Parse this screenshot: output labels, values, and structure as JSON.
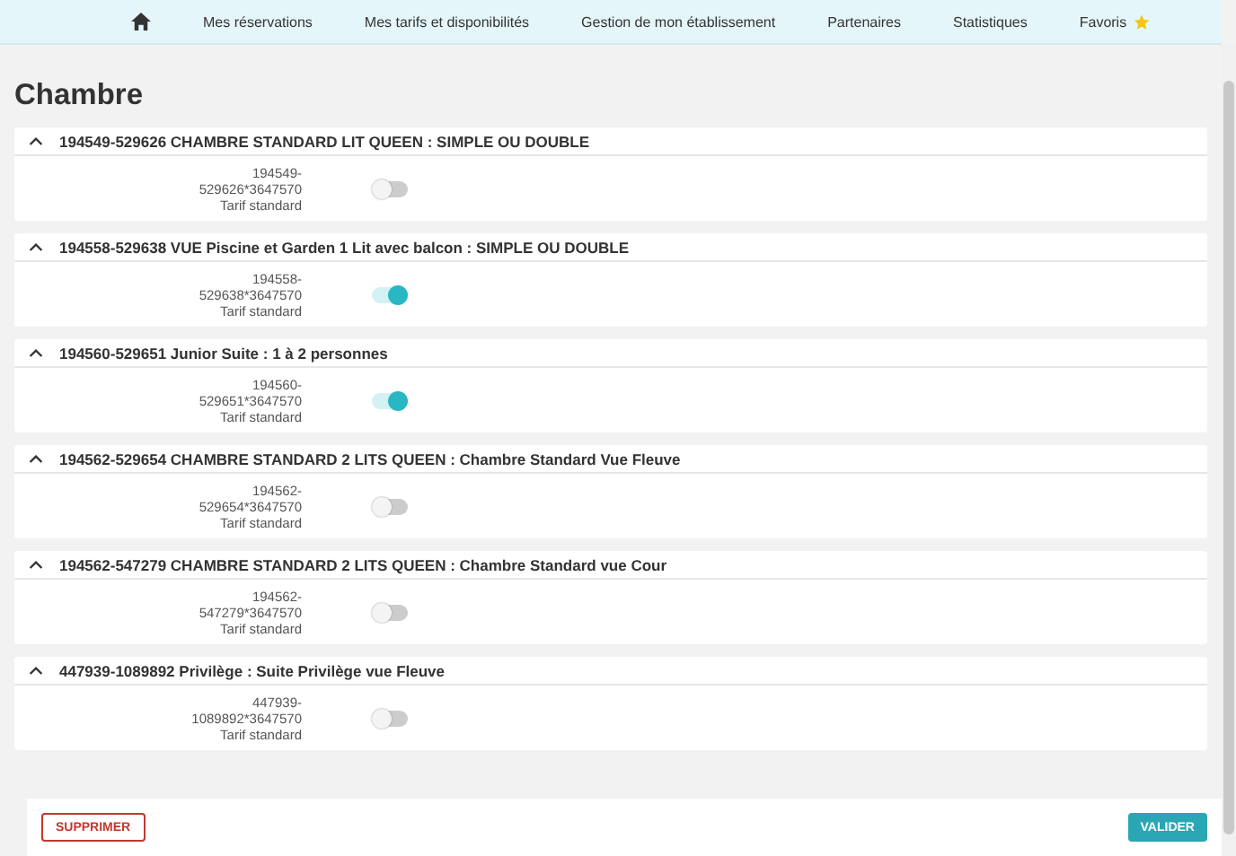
{
  "nav": {
    "items": [
      {
        "label": "Mes réservations"
      },
      {
        "label": "Mes tarifs et disponibilités"
      },
      {
        "label": "Gestion de mon établissement"
      },
      {
        "label": "Partenaires"
      },
      {
        "label": "Statistiques"
      },
      {
        "label": "Favoris"
      }
    ]
  },
  "title": "Chambre",
  "rooms": [
    {
      "name": "194549-529626 CHAMBRE STANDARD LIT QUEEN : SIMPLE OU DOUBLE",
      "code_1": "194549-",
      "code_2": "529626*3647570",
      "rate": "Tarif standard",
      "on": false
    },
    {
      "name": "194558-529638 VUE Piscine et Garden 1 Lit avec balcon : SIMPLE OU DOUBLE",
      "code_1": "194558-",
      "code_2": "529638*3647570",
      "rate": "Tarif standard",
      "on": true
    },
    {
      "name": "194560-529651 Junior Suite : 1 à 2 personnes",
      "code_1": "194560-",
      "code_2": "529651*3647570",
      "rate": "Tarif standard",
      "on": true
    },
    {
      "name": "194562-529654 CHAMBRE STANDARD 2 LITS QUEEN : Chambre Standard Vue Fleuve",
      "code_1": "194562-",
      "code_2": "529654*3647570",
      "rate": "Tarif standard",
      "on": false
    },
    {
      "name": "194562-547279 CHAMBRE STANDARD 2 LITS QUEEN : Chambre Standard vue Cour",
      "code_1": "194562-",
      "code_2": "547279*3647570",
      "rate": "Tarif standard",
      "on": false
    },
    {
      "name": "447939-1089892 Privilège : Suite Privilège vue Fleuve",
      "code_1": "447939-",
      "code_2": "1089892*3647570",
      "rate": "Tarif standard",
      "on": false
    }
  ],
  "footer": {
    "delete_button": "SUPPRIMER",
    "validate_button": "VALIDER"
  }
}
